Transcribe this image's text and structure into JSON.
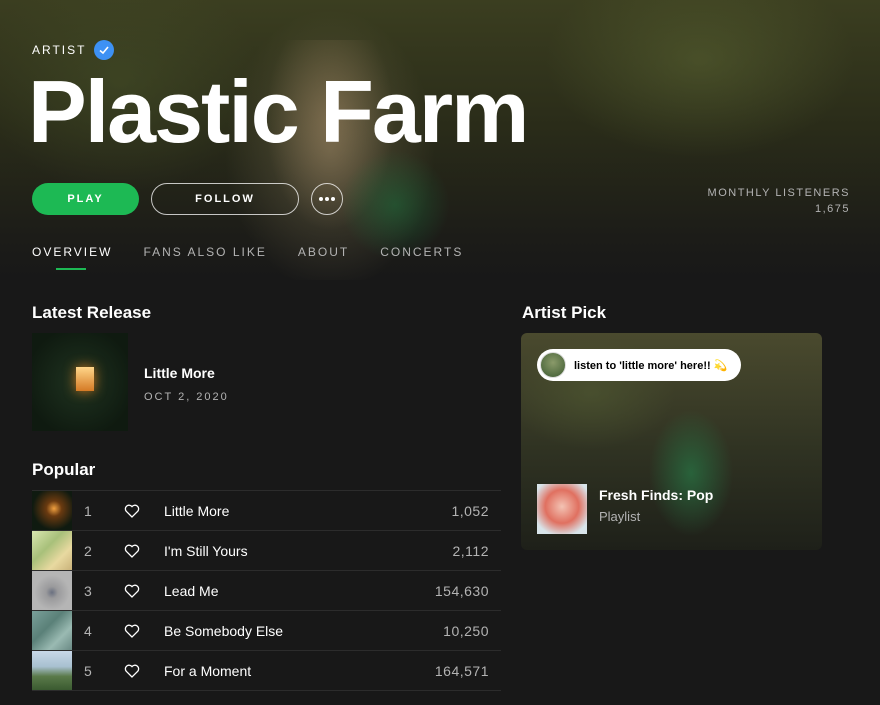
{
  "header": {
    "artist_label": "ARTIST",
    "artist_name": "Plastic Farm",
    "verified": true,
    "play_label": "PLAY",
    "follow_label": "FOLLOW",
    "monthly_listeners_label": "MONTHLY LISTENERS",
    "monthly_listeners_value": "1,675"
  },
  "tabs": [
    {
      "label": "OVERVIEW",
      "active": true
    },
    {
      "label": "FANS ALSO LIKE",
      "active": false
    },
    {
      "label": "ABOUT",
      "active": false
    },
    {
      "label": "CONCERTS",
      "active": false
    }
  ],
  "latest_release": {
    "heading": "Latest Release",
    "title": "Little More",
    "date": "OCT 2, 2020"
  },
  "popular": {
    "heading": "Popular",
    "tracks": [
      {
        "num": "1",
        "title": "Little More",
        "plays": "1,052"
      },
      {
        "num": "2",
        "title": "I'm Still Yours",
        "plays": "2,112"
      },
      {
        "num": "3",
        "title": "Lead Me",
        "plays": "154,630"
      },
      {
        "num": "4",
        "title": "Be Somebody Else",
        "plays": "10,250"
      },
      {
        "num": "5",
        "title": "For a Moment",
        "plays": "164,571"
      }
    ]
  },
  "artist_pick": {
    "heading": "Artist Pick",
    "bubble_text": "listen to 'little more' here!! 💫",
    "playlist_title": "Fresh Finds: Pop",
    "playlist_type": "Playlist"
  },
  "colors": {
    "accent": "#1db954",
    "verified": "#3d91f4",
    "background": "#181818",
    "muted_text": "#b3b3b3"
  },
  "icons": {
    "verified": "verified-check-icon",
    "more": "more-dots-icon",
    "heart": "heart-icon"
  }
}
